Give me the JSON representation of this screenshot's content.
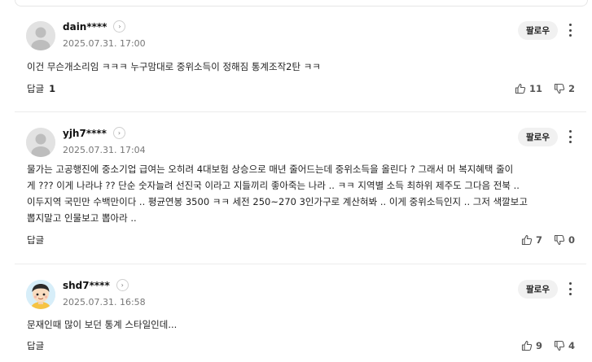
{
  "comments": [
    {
      "username": "dain****",
      "timestamp": "2025.07.31. 17:00",
      "follow_label": "팔로우",
      "text": "이건 무슨개소리임 ㅋㅋㅋ 누구맘대로 중위소득이 정해짐 통계조작2탄 ㅋㅋ",
      "reply_label": "답글",
      "reply_count": "1",
      "likes": "11",
      "dislikes": "2",
      "avatar": "default-avatar"
    },
    {
      "username": "yjh7****",
      "timestamp": "2025.07.31. 17:04",
      "follow_label": "팔로우",
      "text": "물가는 고공행진에 중소기업 급여는 오히려 4대보험 상승으로 매년 줄어드는데 중위소득을 올린다 ? 그래서 머 복지혜택 줄이\n게 ??? 이게 나라냐 ?? 단순 숫자늘려 선진국 이라고 지들끼리 좋아죽는 나라 .. ㅋㅋ 지역별 소득 최하위 제주도 그다음 전북 ..\n이두지역 국민만 수백만이다 .. 평균연봉 3500 ㅋㅋ 세전 250~270 3인가구로 계산혀봐 .. 이게 중위소득인지 .. 그저 색깔보고\n뽑지말고 인물보고 뽑아라 ..",
      "reply_label": "답글",
      "reply_count": "",
      "likes": "7",
      "dislikes": "0",
      "avatar": "default-avatar"
    },
    {
      "username": "shd7****",
      "timestamp": "2025.07.31. 16:58",
      "follow_label": "팔로우",
      "text": "문재인때 많이 보던 통계 스타일인데...",
      "reply_label": "답글",
      "reply_count": "",
      "likes": "9",
      "dislikes": "4",
      "avatar": "cartoon-boy-avatar"
    }
  ],
  "colors": {
    "text": "#222222",
    "muted": "#777777",
    "follow_bg": "#f1f1f1",
    "divider": "#ececec"
  }
}
